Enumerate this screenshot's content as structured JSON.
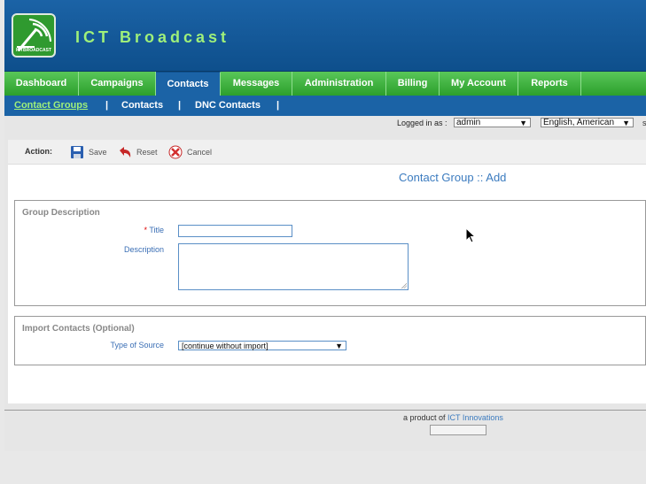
{
  "app": {
    "title": "ICT Broadcast",
    "logo_text": "ICTBROADCAST"
  },
  "nav": {
    "items": [
      {
        "label": "Dashboard",
        "active": false
      },
      {
        "label": "Campaigns",
        "active": false
      },
      {
        "label": "Contacts",
        "active": true
      },
      {
        "label": "Messages",
        "active": false
      },
      {
        "label": "Administration",
        "active": false
      },
      {
        "label": "Billing",
        "active": false
      },
      {
        "label": "My Account",
        "active": false
      },
      {
        "label": "Reports",
        "active": false
      }
    ]
  },
  "subnav": {
    "items": [
      {
        "label": "Contact Groups",
        "current": true
      },
      {
        "label": "Contacts",
        "current": false
      },
      {
        "label": "DNC Contacts",
        "current": false
      }
    ],
    "separator": "|"
  },
  "login": {
    "label": "Logged in as :",
    "user": "admin",
    "language": "English, American",
    "trailing": "s"
  },
  "toolbar": {
    "action_label": "Action:",
    "save_label": "Save",
    "reset_label": "Reset",
    "cancel_label": "Cancel"
  },
  "page": {
    "heading": "Contact Group :: Add"
  },
  "group_description": {
    "legend": "Group Description",
    "title_required": "*",
    "title_label": "Title",
    "title_value": "",
    "description_label": "Description",
    "description_value": ""
  },
  "import_contacts": {
    "legend": "Import Contacts (Optional)",
    "source_label": "Type of Source",
    "source_value": "[continue without import]"
  },
  "footer": {
    "prefix": "a product of",
    "company": "ICT Innovations"
  },
  "colors": {
    "header_blue": "#1b63a6",
    "nav_green": "#3fae3f",
    "title_green": "#9ff07a",
    "link_blue": "#3b7bbf"
  }
}
